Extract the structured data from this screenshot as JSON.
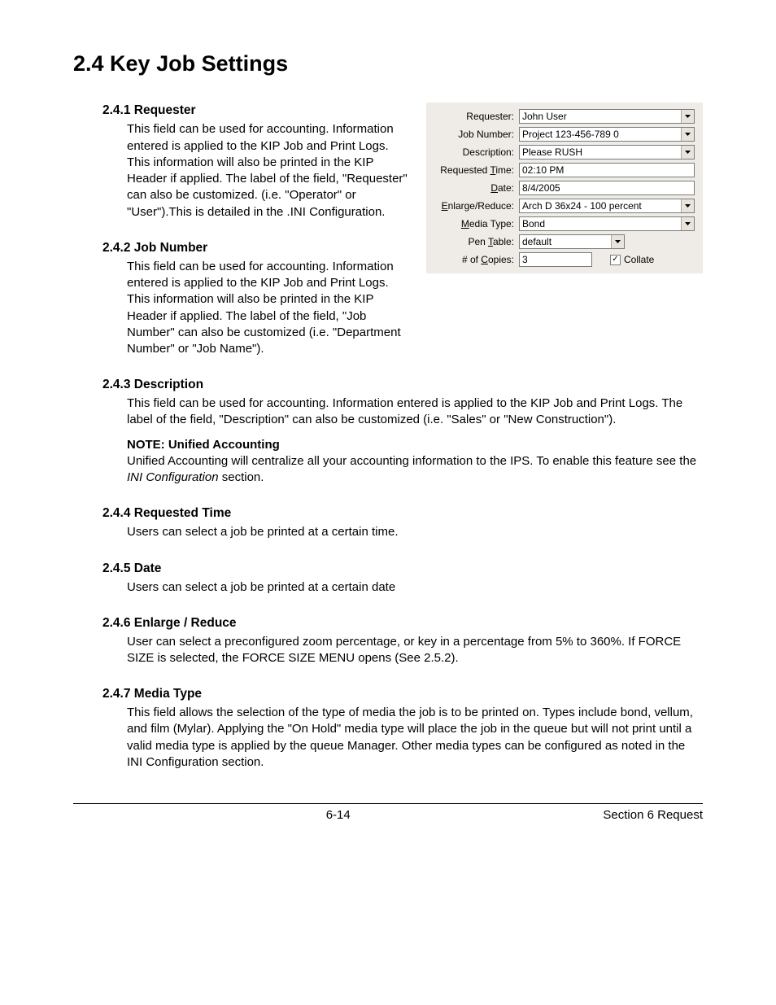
{
  "title": "2.4  Key Job Settings",
  "sections": {
    "s1": {
      "head": "2.4.1    Requester",
      "body": "This field can be used for accounting. Information entered is applied to the KIP Job and Print Logs. This information will also be printed in the KIP Header if applied. The label of the field, \"Requester\" can also be customized.  (i.e. \"Operator\" or \"User\").This is detailed in the .INI Configuration."
    },
    "s2": {
      "head": "2.4.2    Job Number",
      "body": "This field can be used for accounting. Information entered is applied to the KIP Job and Print Logs. This information will also be printed in the KIP Header if applied. The label of the field, \"Job Number\" can also be customized (i.e. \"Department Number\" or \"Job Name\")."
    },
    "s3": {
      "head": "2.4.3    Description",
      "body": "This field can be used for accounting. Information entered is applied to the KIP Job and Print Logs. The label of the field, \"Description\" can also be customized (i.e. \"Sales\" or \"New Construction\").",
      "note_head": "NOTE: Unified Accounting",
      "note_body_a": "Unified Accounting will centralize all your accounting information to the IPS.  To enable this feature see the ",
      "note_body_i": "INI Configuration",
      "note_body_b": " section."
    },
    "s4": {
      "head": "2.4.4    Requested Time",
      "body": "Users can select a job be printed at a certain time."
    },
    "s5": {
      "head": "2.4.5    Date",
      "body": "Users can select a job be printed at a certain date"
    },
    "s6": {
      "head": "2.4.6    Enlarge / Reduce",
      "body": "User can select a preconfigured zoom percentage, or key in a percentage from 5% to 360%.  If FORCE SIZE is selected, the FORCE SIZE MENU opens (See 2.5.2)."
    },
    "s7": {
      "head": "2.4.7    Media Type",
      "body": "This field allows the selection of the type of media the job is to be printed on.  Types include bond, vellum, and film (Mylar).  Applying the \"On Hold\" media type will place the job in the queue but will not print until a valid media type is applied by the queue Manager. Other media types can be configured as noted in the INI Configuration section."
    }
  },
  "form": {
    "requester": {
      "label": "Requester:",
      "value": "John User"
    },
    "job_number": {
      "label": "Job Number:",
      "value": "Project 123-456-789 0"
    },
    "description": {
      "label": "Description:",
      "value": "Please RUSH"
    },
    "req_time": {
      "label_pre": "Requested ",
      "label_u": "T",
      "label_post": "ime:",
      "value": "02:10 PM"
    },
    "date": {
      "label_u": "D",
      "label_post": "ate:",
      "value": "8/4/2005"
    },
    "enlarge": {
      "label_u": "E",
      "label_post": "nlarge/Reduce:",
      "value": "Arch D 36x24 - 100 percent"
    },
    "media": {
      "label_u": "M",
      "label_post": "edia Type:",
      "value": "Bond"
    },
    "pen": {
      "label_pre": "Pen ",
      "label_u": "T",
      "label_post": "able:",
      "value": "default"
    },
    "copies": {
      "label_pre": "# of ",
      "label_u": "C",
      "label_post": "opies:",
      "value": "3"
    },
    "collate": "Collate"
  },
  "footer": {
    "page": "6-14",
    "section": "Section 6     Request"
  }
}
